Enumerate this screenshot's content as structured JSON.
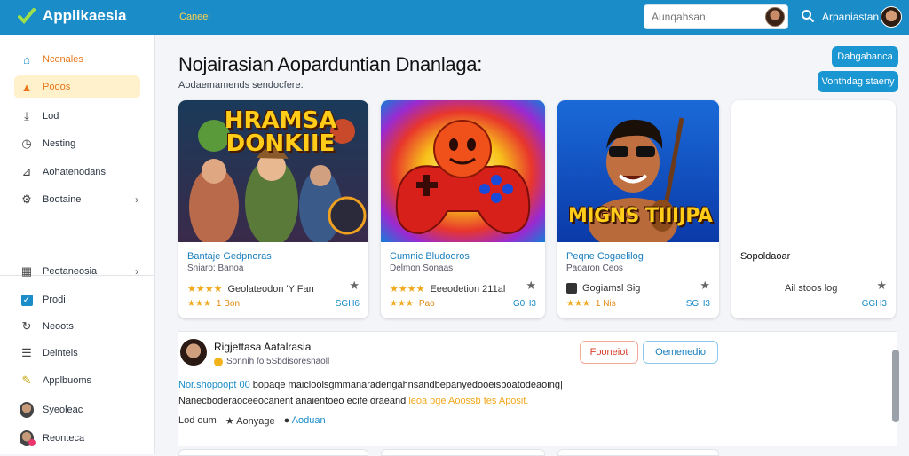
{
  "header": {
    "app_name": "Applikaesia",
    "nav_link": "Caneel",
    "search_placeholder": "Aunqahsan",
    "user_name": "Arpaniastan"
  },
  "sidebar": {
    "items": [
      {
        "label": "Nconales",
        "icon": "home-outline-icon"
      },
      {
        "label": "Pooos",
        "icon": "home-filled-icon"
      },
      {
        "label": "Lod",
        "icon": "download-icon"
      },
      {
        "label": "Nesting",
        "icon": "clock-icon"
      },
      {
        "label": "Aohatenodans",
        "icon": "chart-icon"
      },
      {
        "label": "Bootaine",
        "icon": "settings-icon"
      }
    ],
    "items2": [
      {
        "label": "Peotaneosia",
        "icon": "grid-icon"
      },
      {
        "label": "Prodi",
        "icon": "checkbox-icon"
      },
      {
        "label": "Neoots",
        "icon": "refresh-icon"
      },
      {
        "label": "Delnteis",
        "icon": "list-icon"
      },
      {
        "label": "Applbuoms",
        "icon": "pen-icon"
      },
      {
        "label": "Syeoleac",
        "icon": "avatar-icon"
      },
      {
        "label": "Reonteca",
        "icon": "avatar-icon"
      }
    ]
  },
  "main": {
    "title": "Nojairasian Aoparduntian Dnanlaga:",
    "subtitle": "Aodaemamends sendocfere:",
    "btn_primary": "Dabgabanca",
    "btn_secondary": "Vonthdag staeny"
  },
  "cards": [
    {
      "art_title": "HRAMSA DONKIIE",
      "title": "Bantaje Gedpnoras",
      "meta": "Sniaro: Banoa",
      "stars": "★★★★",
      "stat": "Geolateodon 'Y Fan",
      "rating_stars": "★★★",
      "rating": "1 Bon",
      "count": "SGH6"
    },
    {
      "art_title": "",
      "title": "Cumnic Bludooros",
      "meta": "Delmon Sonaas",
      "stars": "★★★★",
      "stat": "Eeeodetion 211al",
      "rating_stars": "★★★",
      "rating": "Pao",
      "count": "G0H3"
    },
    {
      "art_title": "MIGNS TIIIJPA",
      "title": "Peqne Cogaelilog",
      "meta": "Paoaron Ceos",
      "stars": "",
      "stat": "Gogiamsl Sig",
      "rating_stars": "★★★",
      "rating": "1 Nis",
      "count": "SGH3"
    },
    {
      "art_title": "",
      "title": "Sopoldaoar",
      "meta": "",
      "stars": "",
      "stat": "Ail stoos log",
      "rating_stars": "",
      "rating": "",
      "count": "GGH3"
    }
  ],
  "review": {
    "name": "Rigjettasa Aatalrasia",
    "meta": "Sonnih fo 5Sbdisoresnaoll",
    "btn_follow": "Fooneiot",
    "btn_message": "Oemenedio",
    "line1_hl": "Nor.shopoopt 00",
    "line1": " bopaqe maicloolsgmmanaradengahnsandbepanyedooeisboatodeaoing|",
    "line2": "Nanecboderaoceeocanent anaientoeo ecife oraeand ",
    "line2_hl": "leoa pge Aoossb tes Aposit.",
    "action1": "Lod oum",
    "action2": "Aonyage",
    "action3": "Aoduan"
  }
}
